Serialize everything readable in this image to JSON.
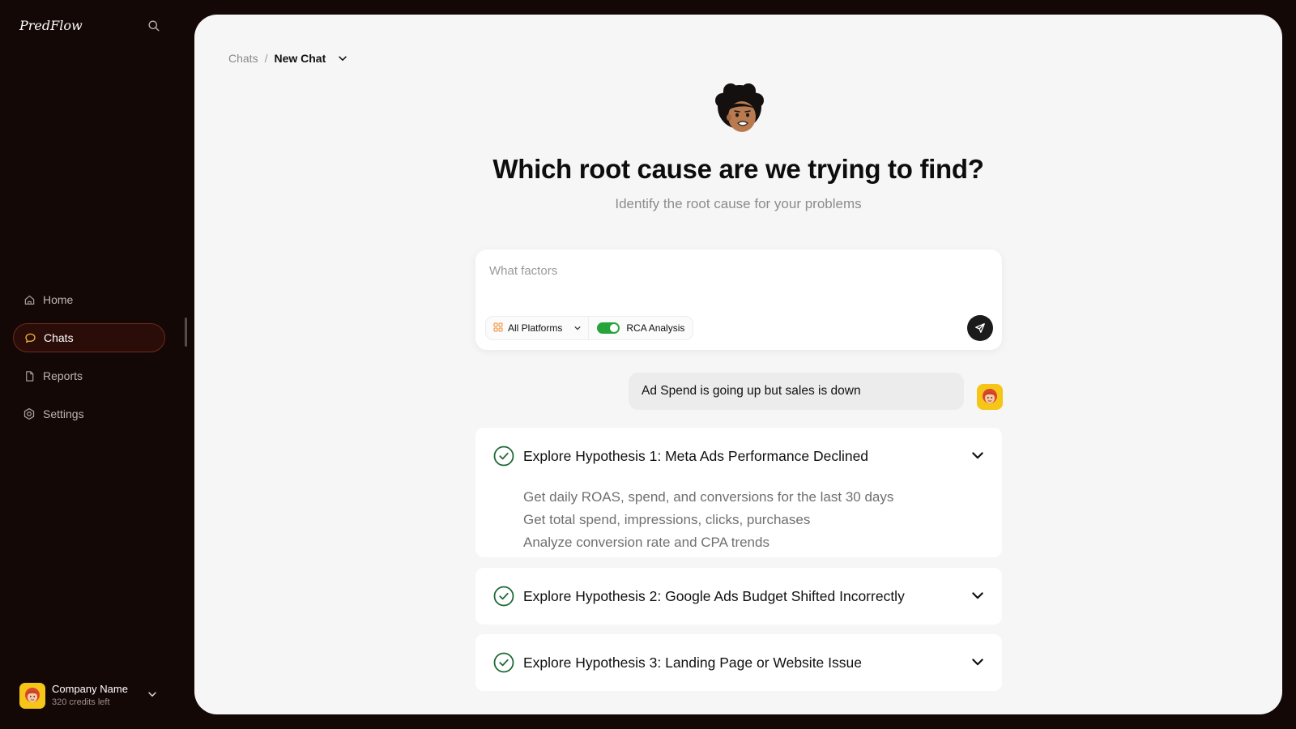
{
  "sidebar": {
    "brand": "PredFlow",
    "nav": [
      {
        "label": "Home",
        "icon": "home-icon",
        "active": false
      },
      {
        "label": "Chats",
        "icon": "chat-icon",
        "active": true
      },
      {
        "label": "Reports",
        "icon": "document-icon",
        "active": false
      },
      {
        "label": "Settings",
        "icon": "gear-icon",
        "active": false
      }
    ],
    "account": {
      "name": "Company Name",
      "credits": "320 credits left"
    }
  },
  "breadcrumb": {
    "parent": "Chats",
    "separator": "/",
    "current": "New Chat"
  },
  "hero": {
    "title": "Which root cause are we trying to find?",
    "subtitle": "Identify the root cause for your problems"
  },
  "composer": {
    "placeholder": "What factors",
    "platform_label": "All Platforms",
    "rca_label": "RCA Analysis",
    "rca_enabled": true
  },
  "conversation": {
    "user_message": "Ad Spend is going up but sales is down"
  },
  "hypotheses": [
    {
      "title": "Explore Hypothesis 1: Meta Ads Performance Declined",
      "expanded": true,
      "steps": [
        "Get daily ROAS, spend, and conversions for the last 30 days",
        "Get total spend, impressions, clicks, purchases",
        "Analyze conversion rate and CPA trends"
      ]
    },
    {
      "title": "Explore Hypothesis 2: Google Ads Budget Shifted Incorrectly",
      "expanded": false
    },
    {
      "title": "Explore Hypothesis 3: Landing Page or Website Issue",
      "expanded": false
    }
  ],
  "colors": {
    "background": "#140807",
    "panel": "#f6f6f6",
    "active_nav_bg": "#2a0d09",
    "active_nav_border": "#6b2a1d",
    "toggle_on": "#27a33c",
    "check_green": "#1f6b37",
    "avatar_yellow": "#f5c518"
  }
}
